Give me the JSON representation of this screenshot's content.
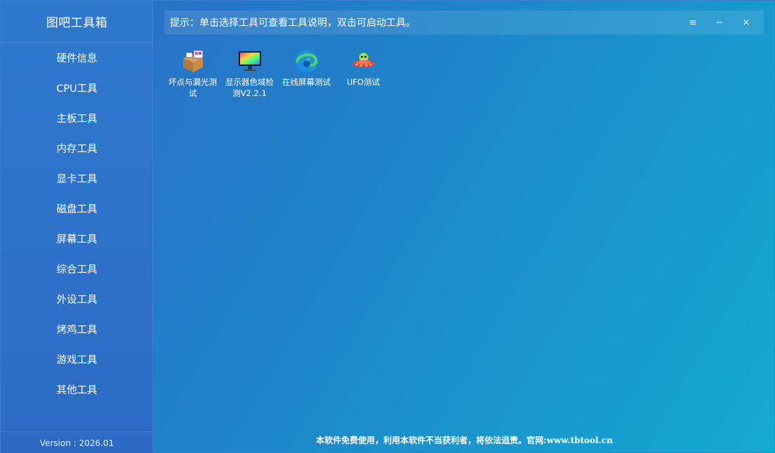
{
  "app": {
    "title": "图吧工具箱"
  },
  "sidebar": {
    "items": [
      {
        "label": "硬件信息"
      },
      {
        "label": "CPU工具"
      },
      {
        "label": "主板工具"
      },
      {
        "label": "内存工具"
      },
      {
        "label": "显卡工具"
      },
      {
        "label": "磁盘工具"
      },
      {
        "label": "屏幕工具"
      },
      {
        "label": "综合工具"
      },
      {
        "label": "外设工具"
      },
      {
        "label": "烤鸡工具"
      },
      {
        "label": "游戏工具"
      },
      {
        "label": "其他工具"
      }
    ],
    "version": "Version : 2026.01"
  },
  "topbar": {
    "hint": "提示：单击选择工具可查看工具说明，双击可启动工具。",
    "menu_icon": "≡",
    "minimize_icon": "−",
    "close_icon": "×"
  },
  "tools": [
    {
      "label": "坏点与漏光测试",
      "icon": "package-icon"
    },
    {
      "label": "显示器色域检测V2.2.1",
      "icon": "monitor-color-icon"
    },
    {
      "label": "在线屏幕测试",
      "icon": "edge-browser-icon"
    },
    {
      "label": "UFO测试",
      "icon": "ufo-icon"
    }
  ],
  "footer": {
    "text": "本软件免费使用，利用本软件不当获利者，将依法追责。官网:www.tbtool.cn"
  },
  "colors": {
    "accent": "#1f84c9",
    "sidebar": "#2d6ac4"
  }
}
